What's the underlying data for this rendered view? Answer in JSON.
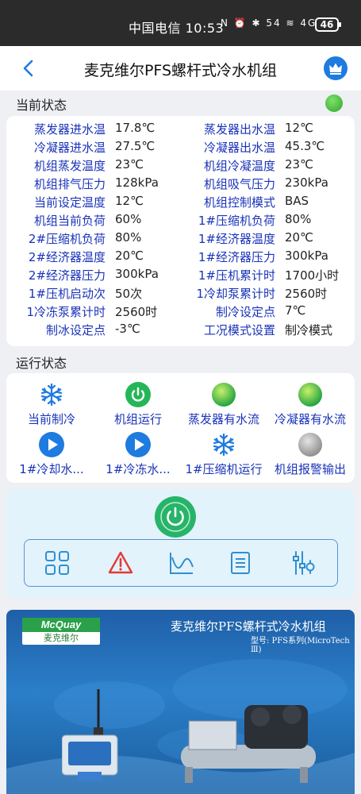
{
  "statusbar": {
    "carrier_time": "中国电信 10:53",
    "icons": "N ⏰ ✱ 54 ≋ 4G",
    "battery": "46"
  },
  "header": {
    "title": "麦克维尔PFS螺杆式冷水机组",
    "back_icon": "chevron-left-icon",
    "crown_icon": "crown-icon"
  },
  "current_status": {
    "title": "当前状态",
    "indicator_color": "#3bb33a",
    "rows": [
      {
        "l1": "蒸发器进水温",
        "v1": "17.8℃",
        "l2": "蒸发器出水温",
        "v2": "12℃"
      },
      {
        "l1": "冷凝器进水温",
        "v1": "27.5℃",
        "l2": "冷凝器出水温",
        "v2": "45.3℃"
      },
      {
        "l1": "机组蒸发温度",
        "v1": "23℃",
        "l2": "机组冷凝温度",
        "v2": "23℃"
      },
      {
        "l1": "机组排气压力",
        "v1": "128kPa",
        "l2": "机组吸气压力",
        "v2": "230kPa"
      },
      {
        "l1": "当前设定温度",
        "v1": "12℃",
        "l2": "机组控制模式",
        "v2": "BAS"
      },
      {
        "l1": "机组当前负荷",
        "v1": "60%",
        "l2": "1#压缩机负荷",
        "v2": "80%"
      },
      {
        "l1": "2#压缩机负荷",
        "v1": "80%",
        "l2": "1#经济器温度",
        "v2": "20℃"
      },
      {
        "l1": "2#经济器温度",
        "v1": "20℃",
        "l2": "1#经济器压力",
        "v2": "300kPa"
      },
      {
        "l1": "2#经济器压力",
        "v1": "300kPa",
        "l2": "1#压机累计时",
        "v2": "1700小时"
      },
      {
        "l1": "1#压机启动次",
        "v1": "50次",
        "l2": "1冷却泵累计时",
        "v2": "2560时"
      },
      {
        "l1": "1冷冻泵累计时",
        "v1": "2560时",
        "l2": "制冷设定点",
        "v2": "7℃"
      },
      {
        "l1": "制冰设定点",
        "v1": "-3℃",
        "l2": "工况模式设置",
        "v2": "制冷模式"
      }
    ]
  },
  "run_status": {
    "title": "运行状态",
    "items": [
      {
        "label": "当前制冷",
        "icon": "snowflake-icon"
      },
      {
        "label": "机组运行",
        "icon": "power-on-icon"
      },
      {
        "label": "蒸发器有水流",
        "icon": "green-indicator-icon"
      },
      {
        "label": "冷凝器有水流",
        "icon": "green-indicator-icon"
      },
      {
        "label": "1#冷却水...",
        "icon": "play-icon"
      },
      {
        "label": "1#冷冻水...",
        "icon": "play-icon"
      },
      {
        "label": "1#压缩机运行",
        "icon": "snowflake-icon"
      },
      {
        "label": "机组报警输出",
        "icon": "gray-indicator-icon"
      }
    ]
  },
  "controls": {
    "power_icon": "power-icon",
    "tools": [
      "grid-icon",
      "warning-icon",
      "chart-icon",
      "document-icon",
      "settings-sliders-icon"
    ]
  },
  "banner": {
    "logo_text": "McQuay",
    "logo_cn": "麦克维尔",
    "title": "麦克维尔PFS螺杆式冷水机组",
    "subtitle": "型号: PFS系列(MicroTech Ⅲ)"
  },
  "colors": {
    "accent": "#1e7be0",
    "label_blue": "#1a33b8",
    "power_green": "#27b46a",
    "panel": "#e3f3fb"
  }
}
